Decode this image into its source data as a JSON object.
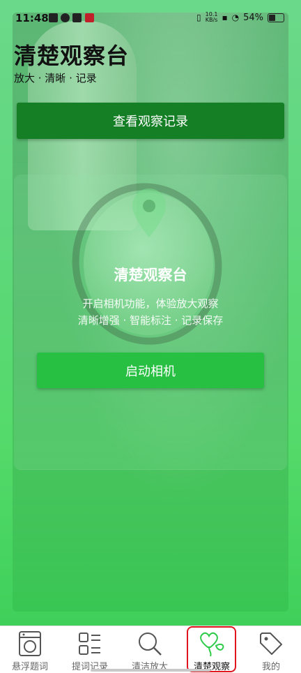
{
  "status_bar": {
    "time": "11:48",
    "network_speed": "10.1\nKB/s",
    "battery": "54%"
  },
  "header": {
    "title": "清楚观察台",
    "subtitle": "放大 · 清晰 · 记录"
  },
  "actions": {
    "view_records": "查看观察记录"
  },
  "card": {
    "title": "清楚观察台",
    "desc_line1": "开启相机功能，体验放大观察",
    "desc_line2": "清晰增强 · 智能标注 · 记录保存",
    "start_camera": "启动相机"
  },
  "tabs": [
    {
      "label": "悬浮题词",
      "icon": "washing-machine-icon",
      "active": false
    },
    {
      "label": "提词记录",
      "icon": "grid-list-icon",
      "active": false
    },
    {
      "label": "清洁放大",
      "icon": "magnifier-icon",
      "active": false
    },
    {
      "label": "清楚观察",
      "icon": "heart-balloon-icon",
      "active": true
    },
    {
      "label": "我的",
      "icon": "tag-icon",
      "active": false
    }
  ],
  "colors": {
    "accent": "#157f26",
    "button_green": "#27c042",
    "highlight": "#e0161e",
    "active_tab_icon": "#2ecc4a"
  }
}
